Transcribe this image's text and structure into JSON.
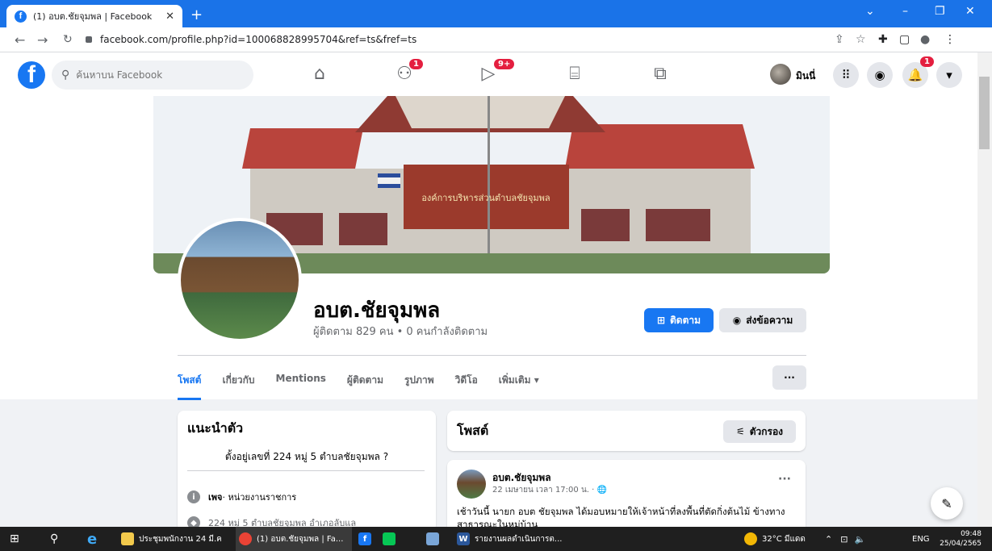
{
  "browser": {
    "tab_title": "(1) อบต.ชัยจุมพล | Facebook",
    "url": "facebook.com/profile.php?id=100068828995704&ref=ts&fref=ts"
  },
  "fb_nav": {
    "search_placeholder": "ค้นหาบน Facebook",
    "friends_badge": "1",
    "watch_badge": "9+",
    "user_name": "มินนี่",
    "notif_badge": "1"
  },
  "profile": {
    "cover_sign": "องค์การบริหารส่วนตำบลชัยจุมพล",
    "name": "อบต.ชัยจุมพล",
    "stats": "ผู้ติดตาม 829 คน • 0 คนกำลังติดตาม",
    "follow_label": "ติดตาม",
    "message_label": "ส่งข้อความ",
    "tabs": [
      "โพสต์",
      "เกี่ยวกับ",
      "Mentions",
      "ผู้ติดตาม",
      "รูปภาพ",
      "วิดีโอ",
      "เพิ่มเติม ▾"
    ],
    "more_label": "···"
  },
  "intro": {
    "title": "แนะนำตัว",
    "bio": "ตั้งอยู่เลขที่ 224 หมู่ 5 ตำบลชัยจุมพล ?",
    "category_bold": "เพจ",
    "category_rest": " · หน่วยงานราชการ",
    "address": "224 หมู่ 5 ตำบลชัยจุมพล อำเภอลับแล"
  },
  "posts": {
    "title": "โพสต์",
    "filter_label": "ตัวกรอง",
    "author": "อบต.ชัยจุมพล",
    "time": "22 เมษายน เวลา 17:00 น. · 🌐",
    "text": "เช้าวันนี้ นายก อบต ชัยจุมพล ได้มอบหมายให้เจ้าหน้าที่ลงพื้นที่ตัดกิ่งต้นไม้ ข้างทางสาธารณะในหมู่บ้าน"
  },
  "taskbar": {
    "folder_label": "ประชุมพนักงาน 24 มี.ค",
    "chrome_label": "(1) อบต.ชัยจุมพล | Fa...",
    "word_label": "รายงานผลดำเนินการต...",
    "weather": "32°C มีแดด",
    "lang": "ENG",
    "time": "09:48",
    "date": "25/04/2565"
  }
}
